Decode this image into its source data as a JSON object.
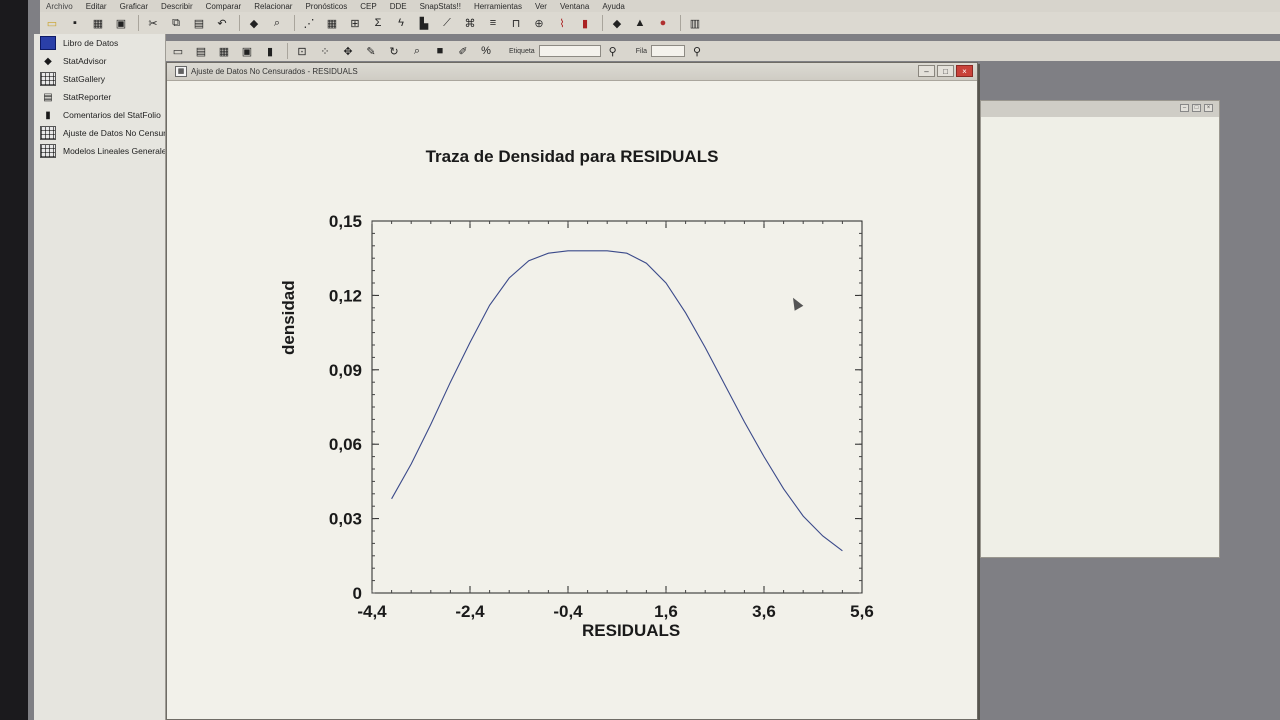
{
  "menu": {
    "items": [
      "Archivo",
      "Editar",
      "Graficar",
      "Describir",
      "Comparar",
      "Relacionar",
      "Pronósticos",
      "CEP",
      "DDE",
      "SnapStats!!",
      "Herramientas",
      "Ver",
      "Ventana",
      "Ayuda"
    ]
  },
  "toolbar2": {
    "etiqueta_label": "Etiqueta",
    "fila_label": "Fila"
  },
  "sidebar": {
    "items": [
      {
        "label": "Libro de Datos",
        "icon": "datasheet-icon"
      },
      {
        "label": "StatAdvisor",
        "icon": "statadvisor-icon"
      },
      {
        "label": "StatGallery",
        "icon": "gallery-icon"
      },
      {
        "label": "StatReporter",
        "icon": "reporter-icon"
      },
      {
        "label": "Comentarios del StatFolio",
        "icon": "comments-icon"
      },
      {
        "label": "Ajuste de Datos No Censurados",
        "icon": "analysis-icon"
      },
      {
        "label": "Modelos Lineales Generales",
        "icon": "analysis-icon"
      }
    ]
  },
  "window": {
    "title": "Ajuste de Datos No Censurados - RESIDUALS"
  },
  "chart_data": {
    "type": "line",
    "title": "Traza de Densidad para RESIDUALS",
    "xlabel": "RESIDUALS",
    "ylabel": "densidad",
    "xlim": [
      -4.4,
      5.6
    ],
    "ylim": [
      0,
      0.15
    ],
    "x_ticks": [
      "-4,4",
      "-2,4",
      "-0,4",
      "1,6",
      "3,6",
      "5,6"
    ],
    "y_ticks": [
      "0",
      "0,03",
      "0,06",
      "0,09",
      "0,12",
      "0,15"
    ],
    "series": [
      {
        "x": [
          -4.0,
          -3.6,
          -3.2,
          -2.8,
          -2.4,
          -2.0,
          -1.6,
          -1.2,
          -0.8,
          -0.4,
          0.0,
          0.4,
          0.8,
          1.2,
          1.6,
          2.0,
          2.4,
          2.8,
          3.2,
          3.6,
          4.0,
          4.4,
          4.8,
          5.2
        ],
        "y": [
          0.038,
          0.052,
          0.068,
          0.085,
          0.101,
          0.116,
          0.127,
          0.134,
          0.137,
          0.138,
          0.138,
          0.138,
          0.137,
          0.133,
          0.125,
          0.113,
          0.099,
          0.084,
          0.069,
          0.055,
          0.042,
          0.031,
          0.023,
          0.017
        ]
      }
    ]
  }
}
